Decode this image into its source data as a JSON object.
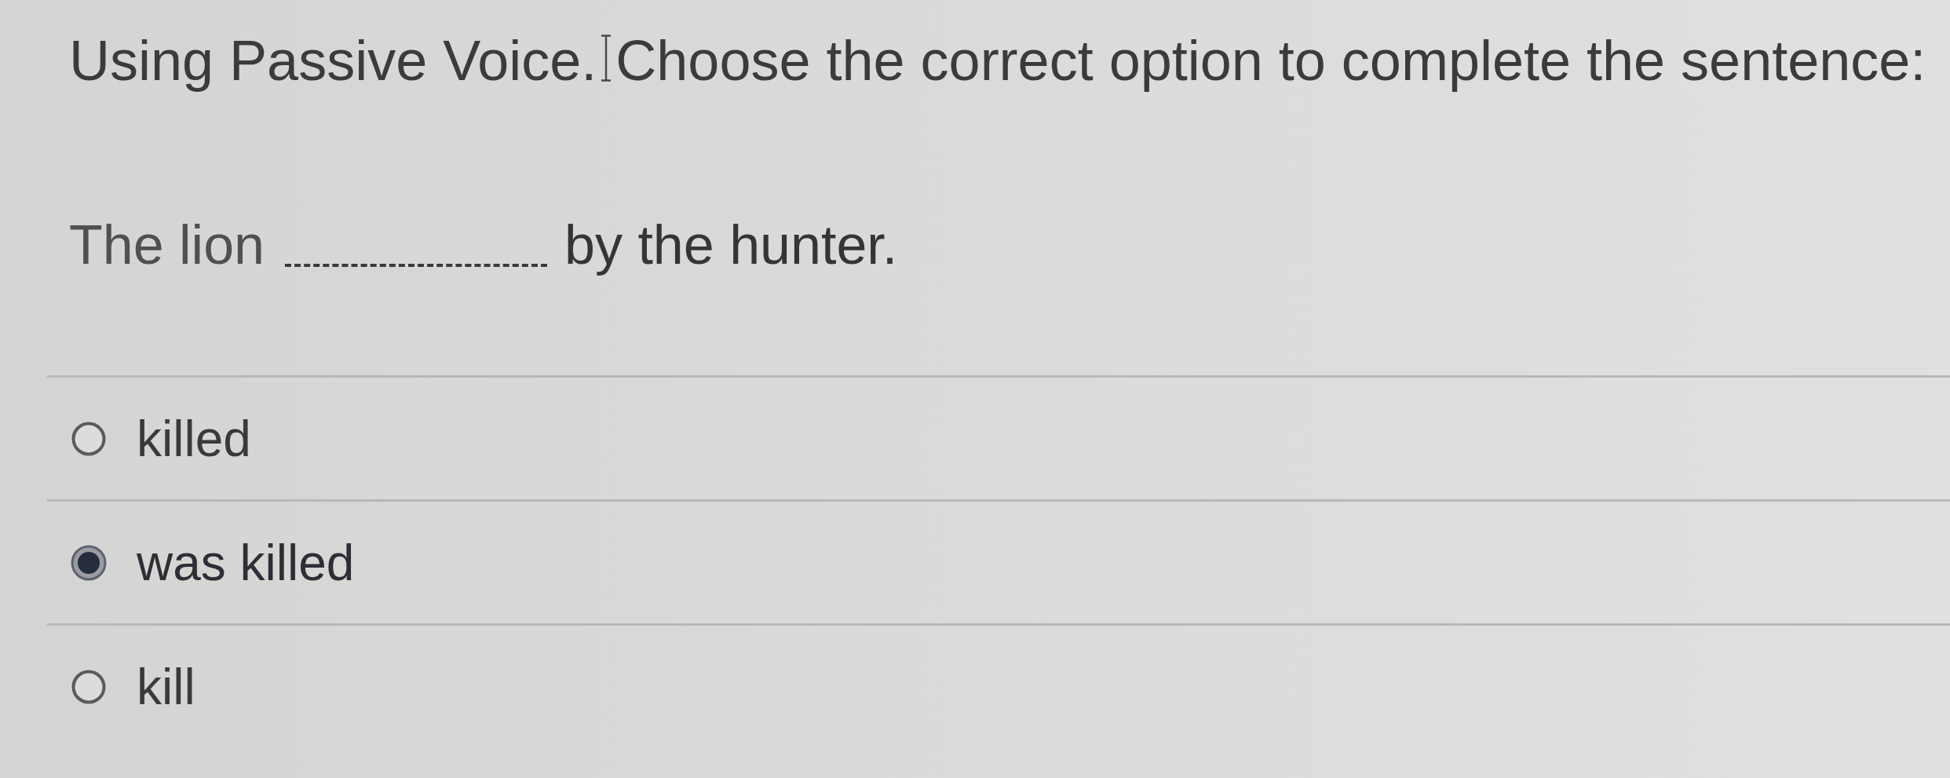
{
  "heading": {
    "title": "Using Passive Voice.",
    "instruction": "Choose the correct option to complete the sentence:"
  },
  "sentence": {
    "start": "The lion",
    "end": "by the hunter."
  },
  "options": [
    {
      "label": "killed",
      "selected": false
    },
    {
      "label": "was killed",
      "selected": true
    },
    {
      "label": "kill",
      "selected": false
    }
  ]
}
